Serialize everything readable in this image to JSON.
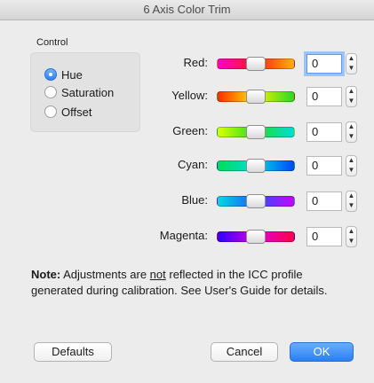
{
  "window": {
    "title": "6 Axis Color Trim"
  },
  "control": {
    "title": "Control",
    "options": [
      {
        "label": "Hue",
        "selected": true
      },
      {
        "label": "Saturation",
        "selected": false
      },
      {
        "label": "Offset",
        "selected": false
      }
    ]
  },
  "channels": [
    {
      "label": "Red:",
      "value": "0",
      "slider_level": 0.5,
      "gradient": [
        "#ff00cc",
        "#ff1a1a",
        "#ffb400"
      ]
    },
    {
      "label": "Yellow:",
      "value": "0",
      "slider_level": 0.5,
      "gradient": [
        "#ff2a00",
        "#ffee00",
        "#22dd22"
      ]
    },
    {
      "label": "Green:",
      "value": "0",
      "slider_level": 0.5,
      "gradient": [
        "#ddff00",
        "#22dd22",
        "#00dddd"
      ]
    },
    {
      "label": "Cyan:",
      "value": "0",
      "slider_level": 0.5,
      "gradient": [
        "#00dd55",
        "#00dddd",
        "#0044ff"
      ]
    },
    {
      "label": "Blue:",
      "value": "0",
      "slider_level": 0.5,
      "gradient": [
        "#00dddd",
        "#2255ff",
        "#cc00ff"
      ]
    },
    {
      "label": "Magenta:",
      "value": "0",
      "slider_level": 0.5,
      "gradient": [
        "#2a00ff",
        "#dd00dd",
        "#ff0044"
      ]
    }
  ],
  "note": {
    "prefix": "Note:",
    "text_before": " Adjustments are ",
    "emphasis": "not",
    "text_after": " reflected in the ICC profile generated during calibration. See User's Guide for details."
  },
  "buttons": {
    "defaults": "Defaults",
    "cancel": "Cancel",
    "ok": "OK"
  },
  "colors": {
    "accent": "#2a7ff4",
    "focus_ring": "#9cc3fa"
  }
}
